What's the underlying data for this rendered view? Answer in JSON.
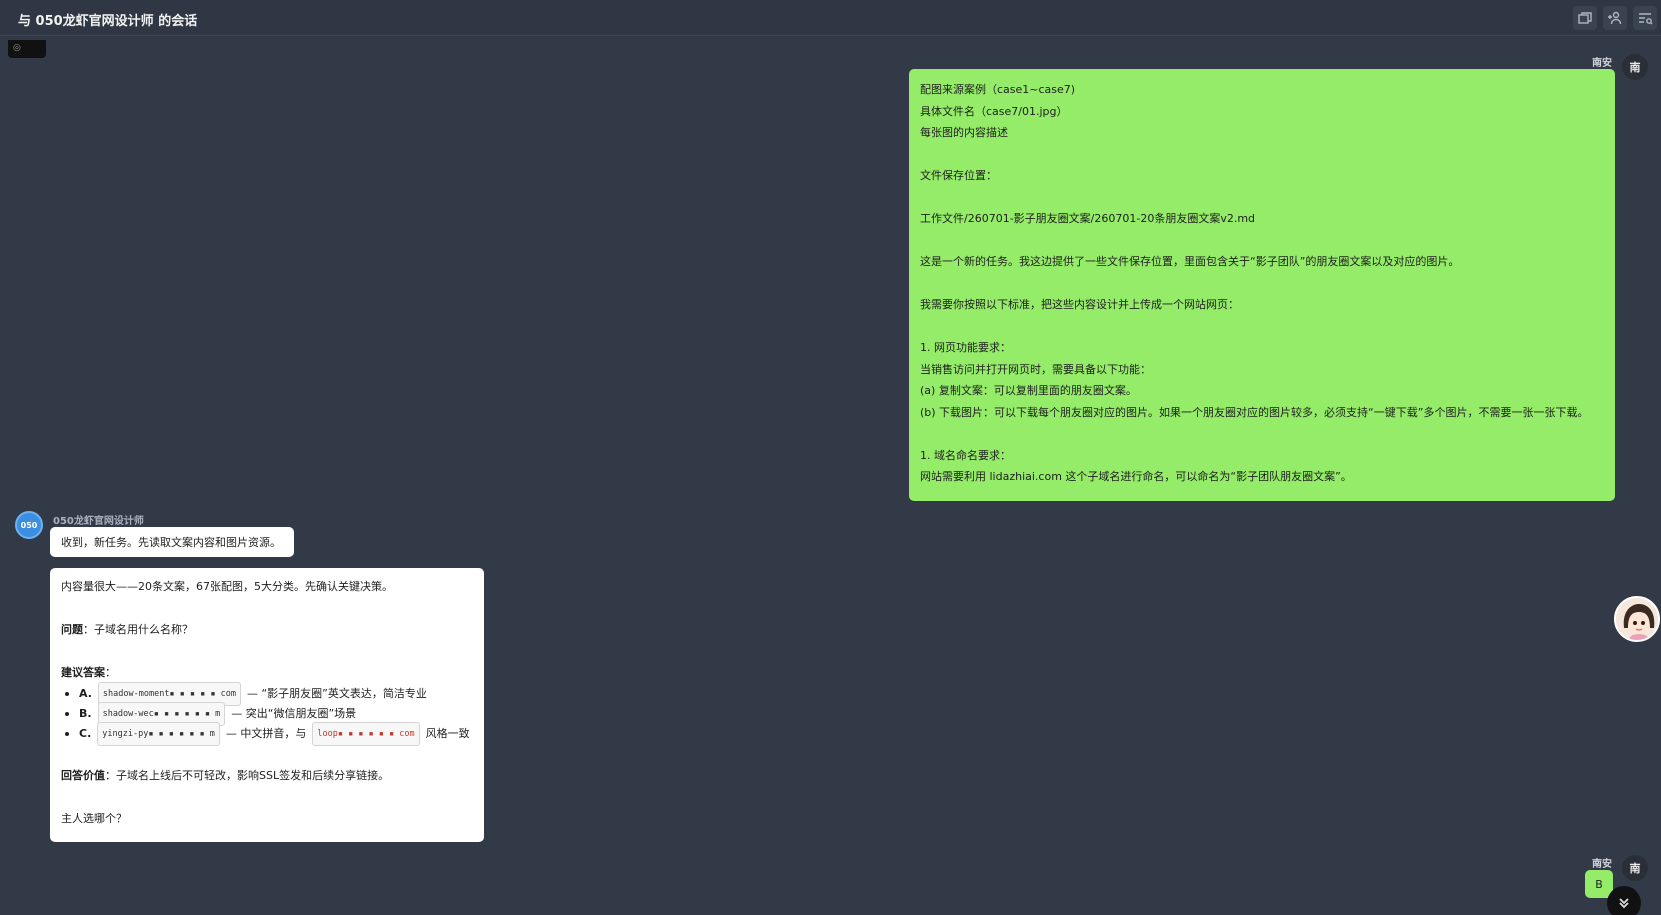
{
  "header": {
    "title": "与 050龙虾官网设计师 的会话",
    "actions": [
      "window-icon",
      "add-user-icon",
      "search-list-icon"
    ]
  },
  "mini_chip": "◎ ",
  "user": {
    "name": "南安",
    "avatar_text": "南"
  },
  "bot": {
    "name": "050龙虾官网设计师",
    "avatar_text": "050"
  },
  "messages": {
    "user_msg_1": {
      "lines": [
        "配图来源案例（case1~case7)",
        "具体文件名（case7/01.jpg）",
        "每张图的内容描述",
        "",
        "文件保存位置：",
        "",
        "工作文件/260701-影子朋友圈文案/260701-20条朋友圈文案v2.md",
        "",
        "这是一个新的任务。我这边提供了一些文件保存位置，里面包含关于“影子团队”的朋友圈文案以及对应的图片。",
        "",
        "我需要你按照以下标准，把这些内容设计并上传成一个网站网页：",
        "",
        "  1. 网页功能要求：",
        "当销售访问并打开网页时，需要具备以下功能：",
        "(a) 复制文案：可以复制里面的朋友圈文案。",
        "(b) 下载图片：可以下载每个朋友圈对应的图片。如果一个朋友圈对应的图片较多，必须支持“一键下载”多个图片，不需要一张一张下载。",
        "",
        "  1. 域名命名要求：",
        "网站需要利用 lidazhiai.com 这个子域名进行命名，可以命名为“影子团队朋友圈文案”。"
      ]
    },
    "bot_msg_1": "收到，新任务。先读取文案内容和图片资源。",
    "bot_msg_2": {
      "intro": "内容量很大——20条文案，67张配图，5大分类。先确认关键决策。",
      "question_label": "问题",
      "question_text": "：子域名用什么名称？",
      "suggest_label": "建议答案",
      "suggest_colon": "：",
      "options": [
        {
          "letter": "A.",
          "code": "shadow-moment▪ ▪ ▪ ▪ ▪ com",
          "desc": "— “影子朋友圈”英文表达，简洁专业"
        },
        {
          "letter": "B.",
          "code": "shadow-wec▪ ▪ ▪ ▪ ▪ ▪ m",
          "desc": "— 突出“微信朋友圈”场景"
        },
        {
          "letter": "C.",
          "code": "yingzi-py▪ ▪ ▪ ▪ ▪ ▪ m",
          "desc": "— 中文拼音，与",
          "code2": "loop▪ ▪ ▪ ▪ ▪ ▪ com",
          "desc2": "风格一致"
        }
      ],
      "value_label": "回答价值",
      "value_text": "：子域名上线后不可轻改，影响SSL签发和后续分享链接。",
      "closing": "主人选哪个？"
    },
    "user_msg_2": "B"
  }
}
